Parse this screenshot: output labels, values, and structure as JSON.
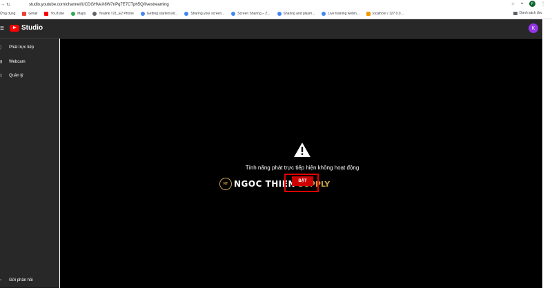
{
  "browser": {
    "url": "studio.youtube.com/channel/UCDGHVeX8W7nPq7E7CTph5Q/livestreaming",
    "profile_initial": "F"
  },
  "bookmarks": {
    "items": [
      {
        "label": "Ứng dụng",
        "color": "#4285f4"
      },
      {
        "label": "Gmail",
        "color": "#ea4335"
      },
      {
        "label": "YouTube",
        "color": "#ff0000"
      },
      {
        "label": "Maps",
        "color": "#34a853"
      },
      {
        "label": "Yealink T21_E2 Phone",
        "color": "#5f6368"
      },
      {
        "label": "Getting started wit...",
        "color": "#4285f4"
      },
      {
        "label": "Sharing your screen...",
        "color": "#4285f4"
      },
      {
        "label": "Screen Sharing – Z...",
        "color": "#4285f4"
      },
      {
        "label": "Sharing and playm...",
        "color": "#4285f4"
      },
      {
        "label": "Live training webin...",
        "color": "#4285f4"
      },
      {
        "label": "localhost / 127.0.0....",
        "color": "#f29900"
      }
    ],
    "reading_list": "Danh sách đọc"
  },
  "header": {
    "logo_text": "Studio",
    "avatar_initial": "K"
  },
  "sidebar": {
    "items": [
      {
        "label": "Phát trực tiếp"
      },
      {
        "label": "Webcam"
      },
      {
        "label": "Quản lý"
      }
    ],
    "feedback": "Gửi phản hồi"
  },
  "main": {
    "message": "Tính năng phát trực tiếp hiện không hoạt động",
    "button_label": "BẬT"
  },
  "watermark": {
    "badge": "NT",
    "text_main": "NGOC THIEN",
    "text_secondary": "SUPPLY"
  },
  "colors": {
    "accent": "#cc0000",
    "highlight": "#e00000",
    "sidebar_bg": "#282828",
    "main_bg": "#000000"
  }
}
